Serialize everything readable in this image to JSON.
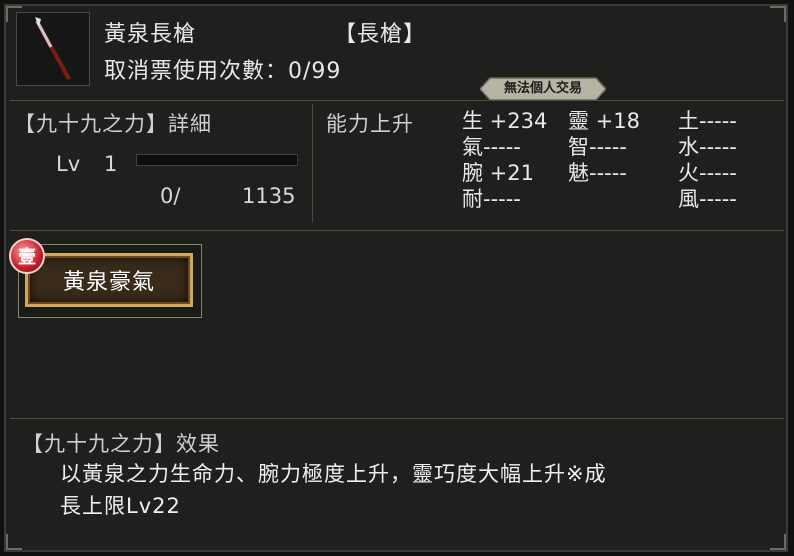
{
  "item": {
    "name": "黃泉長槍",
    "type": "【長槍】",
    "cancel_label": "取消票使用次數：",
    "cancel_value": "0/99",
    "badge": "無法個人交易",
    "icon": "spear-icon"
  },
  "detail": {
    "title": "【九十九之力】詳細",
    "lv_label": "Lv",
    "lv_value": "1",
    "exp_current": "0/",
    "exp_max": "1135",
    "exp_progress": 0
  },
  "ability": {
    "title": "能力上升",
    "col1": [
      "生 +234",
      "氣-----",
      "腕 +21",
      "耐-----"
    ],
    "col2": [
      "靈 +18",
      "智-----",
      "魅-----"
    ],
    "col3": [
      "土-----",
      "水-----",
      "火-----",
      "風-----"
    ]
  },
  "skill": {
    "tier": "壹",
    "name": "黃泉豪氣"
  },
  "effect": {
    "title": "【九十九之力】效果",
    "line1": "以黃泉之力生命力、腕力極度上升，靈巧度大幅上升※成",
    "line2": "長上限Lv22"
  },
  "colors": {
    "panel": "#1f1f1d",
    "border": "#3a3a36",
    "skill_gold": "#d0a85a",
    "tier_red": "#c01f2a"
  }
}
